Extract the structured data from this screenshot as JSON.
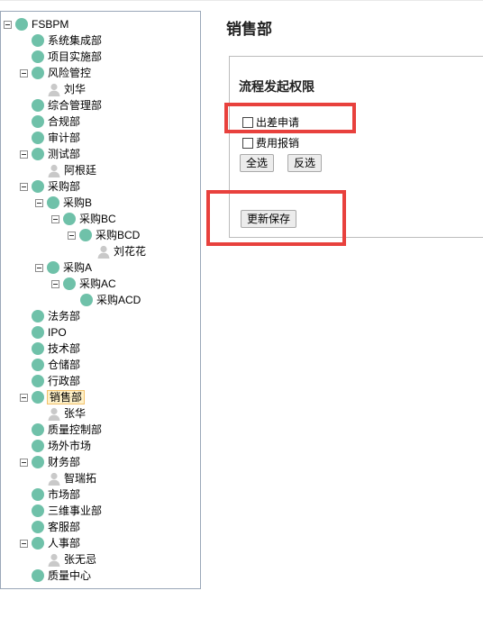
{
  "tree": {
    "nodes": [
      {
        "label": "FSBPM",
        "expanded": true
      },
      {
        "label": "系统集成部"
      },
      {
        "label": "项目实施部"
      },
      {
        "label": "风险管控",
        "expanded": true
      },
      {
        "label": "刘华",
        "user": true
      },
      {
        "label": "综合管理部"
      },
      {
        "label": "合规部"
      },
      {
        "label": "审计部"
      },
      {
        "label": "测试部",
        "expanded": true
      },
      {
        "label": "阿根廷",
        "user": true
      },
      {
        "label": "采购部",
        "expanded": true
      },
      {
        "label": "采购B",
        "expanded": true
      },
      {
        "label": "采购BC",
        "expanded": true
      },
      {
        "label": "采购BCD",
        "expanded": true
      },
      {
        "label": "刘花花",
        "user": true
      },
      {
        "label": "采购A",
        "expanded": true
      },
      {
        "label": "采购AC",
        "expanded": true
      },
      {
        "label": "采购ACD"
      },
      {
        "label": "法务部"
      },
      {
        "label": "IPO"
      },
      {
        "label": "技术部"
      },
      {
        "label": "仓储部"
      },
      {
        "label": "行政部"
      },
      {
        "label": "销售部",
        "expanded": true,
        "selected": true
      },
      {
        "label": "张华",
        "user": true
      },
      {
        "label": "质量控制部"
      },
      {
        "label": "场外市场"
      },
      {
        "label": "财务部",
        "expanded": true
      },
      {
        "label": "智瑞拓",
        "user": true
      },
      {
        "label": "市场部"
      },
      {
        "label": "三维事业部"
      },
      {
        "label": "客服部"
      },
      {
        "label": "人事部",
        "expanded": true
      },
      {
        "label": "张无忌",
        "user": true
      },
      {
        "label": "质量中心"
      }
    ]
  },
  "main": {
    "title": "销售部",
    "section_title": "流程发起权限",
    "permissions": [
      {
        "label": "出差申请",
        "checked": false
      },
      {
        "label": "费用报销",
        "checked": false
      }
    ],
    "select_all_label": "全选",
    "invert_label": "反选",
    "save_label": "更新保存"
  },
  "colors": {
    "node_dot": "#6fc1a9",
    "highlight": "#e8413d",
    "selected_bg": "#fff1c8"
  }
}
